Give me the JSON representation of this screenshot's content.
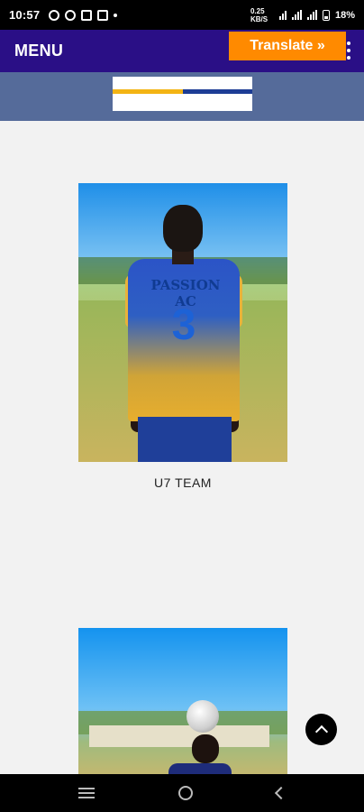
{
  "status_bar": {
    "time": "10:57",
    "network_text": "0.25 KB/S",
    "battery": "18%"
  },
  "header": {
    "menu_label": "MENU",
    "translate_label": "Translate »"
  },
  "content": {
    "team_caption": "U7 TEAM",
    "jersey_text": "PASSION AC",
    "jersey_number": "3"
  },
  "icons": {
    "kebab": "more-vert-icon",
    "scroll_top": "chevron-up-icon",
    "nav_recents": "recents-icon",
    "nav_home": "home-icon",
    "nav_back": "back-icon"
  },
  "colors": {
    "header_bg": "#2a0f86",
    "translate_bg": "#ff8a00",
    "logo_band_bg": "#556b9a",
    "logo_yellow": "#f3b414",
    "logo_blue": "#1d3d95"
  }
}
